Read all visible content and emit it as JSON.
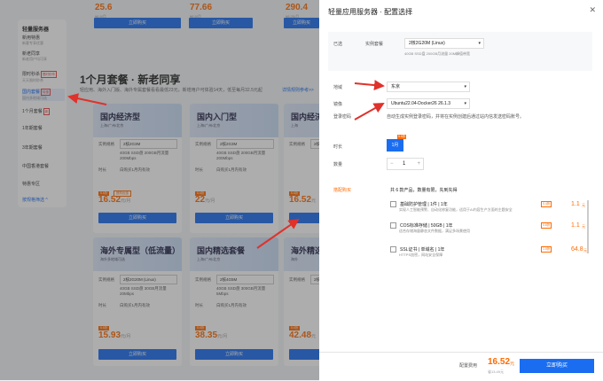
{
  "background": {
    "top_prices": [
      "25.6",
      "77.66",
      "290.4"
    ],
    "top_price_notes": [
      "¥6.9/月",
      "¥6.5/月",
      "¥8.25/月"
    ],
    "sidebar": {
      "title": "轻量服务器",
      "items": [
        {
          "label": "新用特惠",
          "sub": "新客专享优惠"
        },
        {
          "label": "新老同享",
          "sub": "新老用户均可享"
        },
        {
          "label": "限时秒杀",
          "sub": "天天限时秒杀",
          "tag": "限时秒杀"
        },
        {
          "label": "国内套餐",
          "sub": "国内多地域可选",
          "tag": "特惠"
        },
        {
          "label": "1个月套餐",
          "tag": "新"
        },
        {
          "label": "1年期套餐"
        },
        {
          "label": "3年期套餐"
        },
        {
          "label": "中国香港套餐"
        },
        {
          "label": "特惠专区"
        }
      ],
      "link": "按规格筛选 ^"
    },
    "section_title": "1个月套餐 · 新老同享",
    "section_sub": "轻应用、海外入门版、海外专属套餐看看最低23元，新增用户可体验14天，低至每月32.5元起",
    "section_link": "详情规则参考>>",
    "cards_row1": [
      {
        "title": "国内经济型",
        "sub": "上海/广州/北京",
        "spec": "2核2G3M",
        "specs": "40GB SSD盘 200GB月流量 200Mbps",
        "dur": "白购买1月内有效",
        "price": "16.52",
        "price_unit": "元/月",
        "badges": [
          "5.6折",
          "首购优惠"
        ]
      },
      {
        "title": "国内入门型",
        "sub": "上海/广州/北京",
        "spec": "2核2G3M",
        "specs": "40GB SSD盘 200GB月流量 200Mbps",
        "dur": "白购买1月内有效",
        "price": "22",
        "price_unit": "元/月",
        "badges": [
          "5.6折"
        ]
      },
      {
        "title": "国内经济",
        "sub": "上海",
        "spec": "2核4",
        "specs": "40GB",
        "dur": "白购买1",
        "price": "16.52",
        "price_unit": "元",
        "badges": [
          "5.6折"
        ]
      }
    ],
    "cards_row2": [
      {
        "title": "海外专属型（低流量）",
        "sub": "海外多地域可选",
        "spec": "2核2G20M (Linux)",
        "specs": "40GB SSD盘 30GB月流量 20Mbps",
        "dur": "白购买1月内有效",
        "price": "15.93",
        "price_unit": "元/月",
        "badges": [
          "5.6折"
        ]
      },
      {
        "title": "国内精选套餐",
        "sub": "上海/广州/北京",
        "spec": "2核4G5M",
        "specs": "40GB SSD盘 300GB月流量 5Mbps",
        "dur": "白购买1月内有效",
        "price": "38.35",
        "price_unit": "元/月",
        "badges": [
          "5.6折"
        ]
      },
      {
        "title": "海外精选套餐",
        "sub": "海外",
        "spec": "2核2",
        "specs": "40GB",
        "dur": "白购买1",
        "price": "42.48",
        "price_unit": "元",
        "badges": [
          "5.6折"
        ]
      }
    ],
    "buy_label": "立即购买",
    "row_labels": {
      "spec": "实例规格",
      "dur": "时长"
    }
  },
  "panel": {
    "title": "轻量应用服务器 · 配置选择",
    "close": "✕",
    "package_label": "已选",
    "package_type": "实例套餐",
    "package_value": "2核2G20M (Linux)",
    "package_desc": "40GB SSD盘 200GB月流量 20M峰值带宽",
    "region_label": "地域",
    "region_value": "东京",
    "image_label": "镜像",
    "image_value": "Ubuntu22.04-Docker26 26.1.3",
    "login_label": "登录密码",
    "login_value": "自动生成实例登录密码，并将在实例创建后通过站内信发送密码账号。",
    "duration_label": "时长",
    "duration_value": "1月",
    "duration_badge": "5.6折",
    "qty_label": "数量",
    "qty_value": "1",
    "addon_label": "搭配购买",
    "addon_header": "共 6 款产品，数量有限，先到先得",
    "addons": [
      {
        "name": "基础防护管理 | 1件 | 1年",
        "desc": "实现人工智能预警、自动化修复功能，适用于AI内容生产方面的主题安全",
        "badge": "0.4折",
        "price": "1.1",
        "unit": "元"
      },
      {
        "name": "COS标准存储 | 50GB | 1年",
        "desc": "适合存储海量静态文件数据，满足多场景使用",
        "badge": "0.6折",
        "price": "1.1",
        "unit": "元"
      },
      {
        "name": "SSL证书 | 单域名 | 1年",
        "desc": "HTTPS加密，网站安全保障",
        "badge": "1.0折",
        "price": "64.8",
        "unit": "元"
      }
    ],
    "footer": {
      "label": "配置费用",
      "price": "16.52",
      "unit": "元",
      "note": "省13.49元",
      "confirm": "立即购买"
    }
  }
}
